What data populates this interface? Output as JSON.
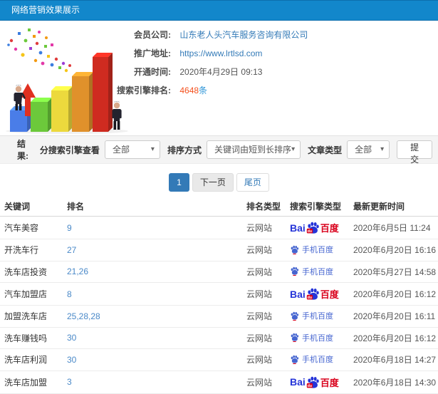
{
  "header": {
    "title": "网络营销效果展示"
  },
  "info": {
    "company_label": "会员公司:",
    "company_value": "山东老人头汽车服务咨询有限公司",
    "url_label": "推广地址:",
    "url_value": "https://www.lrtlsd.com",
    "open_time_label": "开通时间:",
    "open_time_value": "2020年4月29日 09:13",
    "rank_label": "搜索引擎排名:",
    "rank_count": "4648",
    "rank_unit": "条"
  },
  "filter": {
    "result_label": "结果:",
    "engine_label": "分搜索引擎查看",
    "engine_value": "全部",
    "sort_label": "排序方式",
    "sort_value": "关键词由短到长排序",
    "article_label": "文章类型",
    "article_value": "全部",
    "submit_label": "提交"
  },
  "pagination": {
    "current": "1",
    "next_label": "下一页",
    "last_label": "尾页"
  },
  "table": {
    "headers": [
      "关键词",
      "排名",
      "排名类型",
      "搜索引擎类型",
      "最新更新时间"
    ],
    "engines": {
      "baidu": {
        "prefix": "Bai",
        "du": "du",
        "suffix": "百度"
      },
      "mobile": {
        "text": "手机百度"
      }
    },
    "rows": [
      {
        "keyword": "汽车美容",
        "rank": "9",
        "rank_type": "云网站",
        "engine": "baidu",
        "time": "2020年6月5日 11:24"
      },
      {
        "keyword": "开洗车行",
        "rank": "27",
        "rank_type": "云网站",
        "engine": "mobile",
        "time": "2020年6月20日 16:16"
      },
      {
        "keyword": "洗车店投资",
        "rank": "21,26",
        "rank_type": "云网站",
        "engine": "mobile",
        "time": "2020年5月27日 14:58"
      },
      {
        "keyword": "汽车加盟店",
        "rank": "8",
        "rank_type": "云网站",
        "engine": "baidu",
        "time": "2020年6月20日 16:12"
      },
      {
        "keyword": "加盟洗车店",
        "rank": "25,28,28",
        "rank_type": "云网站",
        "engine": "mobile",
        "time": "2020年6月20日 16:11"
      },
      {
        "keyword": "洗车赚钱吗",
        "rank": "30",
        "rank_type": "云网站",
        "engine": "mobile",
        "time": "2020年6月20日 16:12"
      },
      {
        "keyword": "洗车店利润",
        "rank": "30",
        "rank_type": "云网站",
        "engine": "mobile",
        "time": "2020年6月18日 14:27"
      },
      {
        "keyword": "洗车店加盟",
        "rank": "3",
        "rank_type": "云网站",
        "engine": "baidu",
        "time": "2020年6月18日 14:30"
      }
    ]
  },
  "illustration": {
    "bar_colors": [
      "#4a7de8",
      "#6cc93b",
      "#ecd93d",
      "#e0912b",
      "#cf2b20"
    ],
    "arrow_color": "#e03020"
  },
  "colors": {
    "header_bg": "#1287cb",
    "link_blue": "#337ab7",
    "rank_link": "#4a89c8",
    "count_red": "#f4511e",
    "unit_blue": "#2f96d8",
    "baidu_blue": "#2534d8",
    "baidu_red": "#d9001b",
    "mobile_blue": "#4565d0",
    "filter_bg": "#f4f4f4",
    "page_active": "#337ab7"
  }
}
